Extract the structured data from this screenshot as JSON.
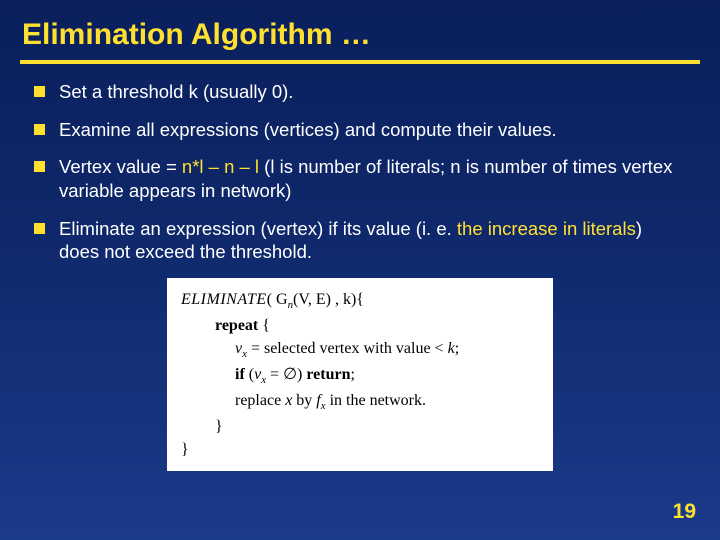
{
  "title": "Elimination Algorithm …",
  "bullets": [
    {
      "text": "Set a threshold k (usually 0)."
    },
    {
      "text": "Examine all expressions (vertices) and compute their values."
    },
    {
      "prefix": "Vertex value = ",
      "formula": "n*l – n – l",
      "suffix": "  (l is number of literals; n is number of times vertex variable appears in network)"
    },
    {
      "prefix": "Eliminate an expression (vertex) if its value (i. e. ",
      "hl": "the increase in literals",
      "suffix": ") does not exceed the threshold."
    }
  ],
  "algo": {
    "head_fn": "ELIMINATE",
    "head_args": "( G",
    "head_sub": "n",
    "head_rest": "(V, E) , k){",
    "repeat": "repeat",
    "brace_open": " {",
    "line_sel_lhs": "v",
    "line_sel_sub": "x",
    "line_sel_eq": " = selected vertex with value < ",
    "line_sel_k": "k",
    "line_sel_end": ";",
    "line_if_kw": "if",
    "line_if_open": " (",
    "line_if_v": "v",
    "line_if_sub": "x",
    "line_if_eq": " = ∅) ",
    "line_if_ret": "return",
    "line_if_end": ";",
    "line_rep_a": "replace ",
    "line_rep_x": "x",
    "line_rep_b": " by ",
    "line_rep_f": "f",
    "line_rep_fsub": "x",
    "line_rep_c": " in the network.",
    "brace_close1": "}",
    "brace_close2": "}"
  },
  "page": "19"
}
